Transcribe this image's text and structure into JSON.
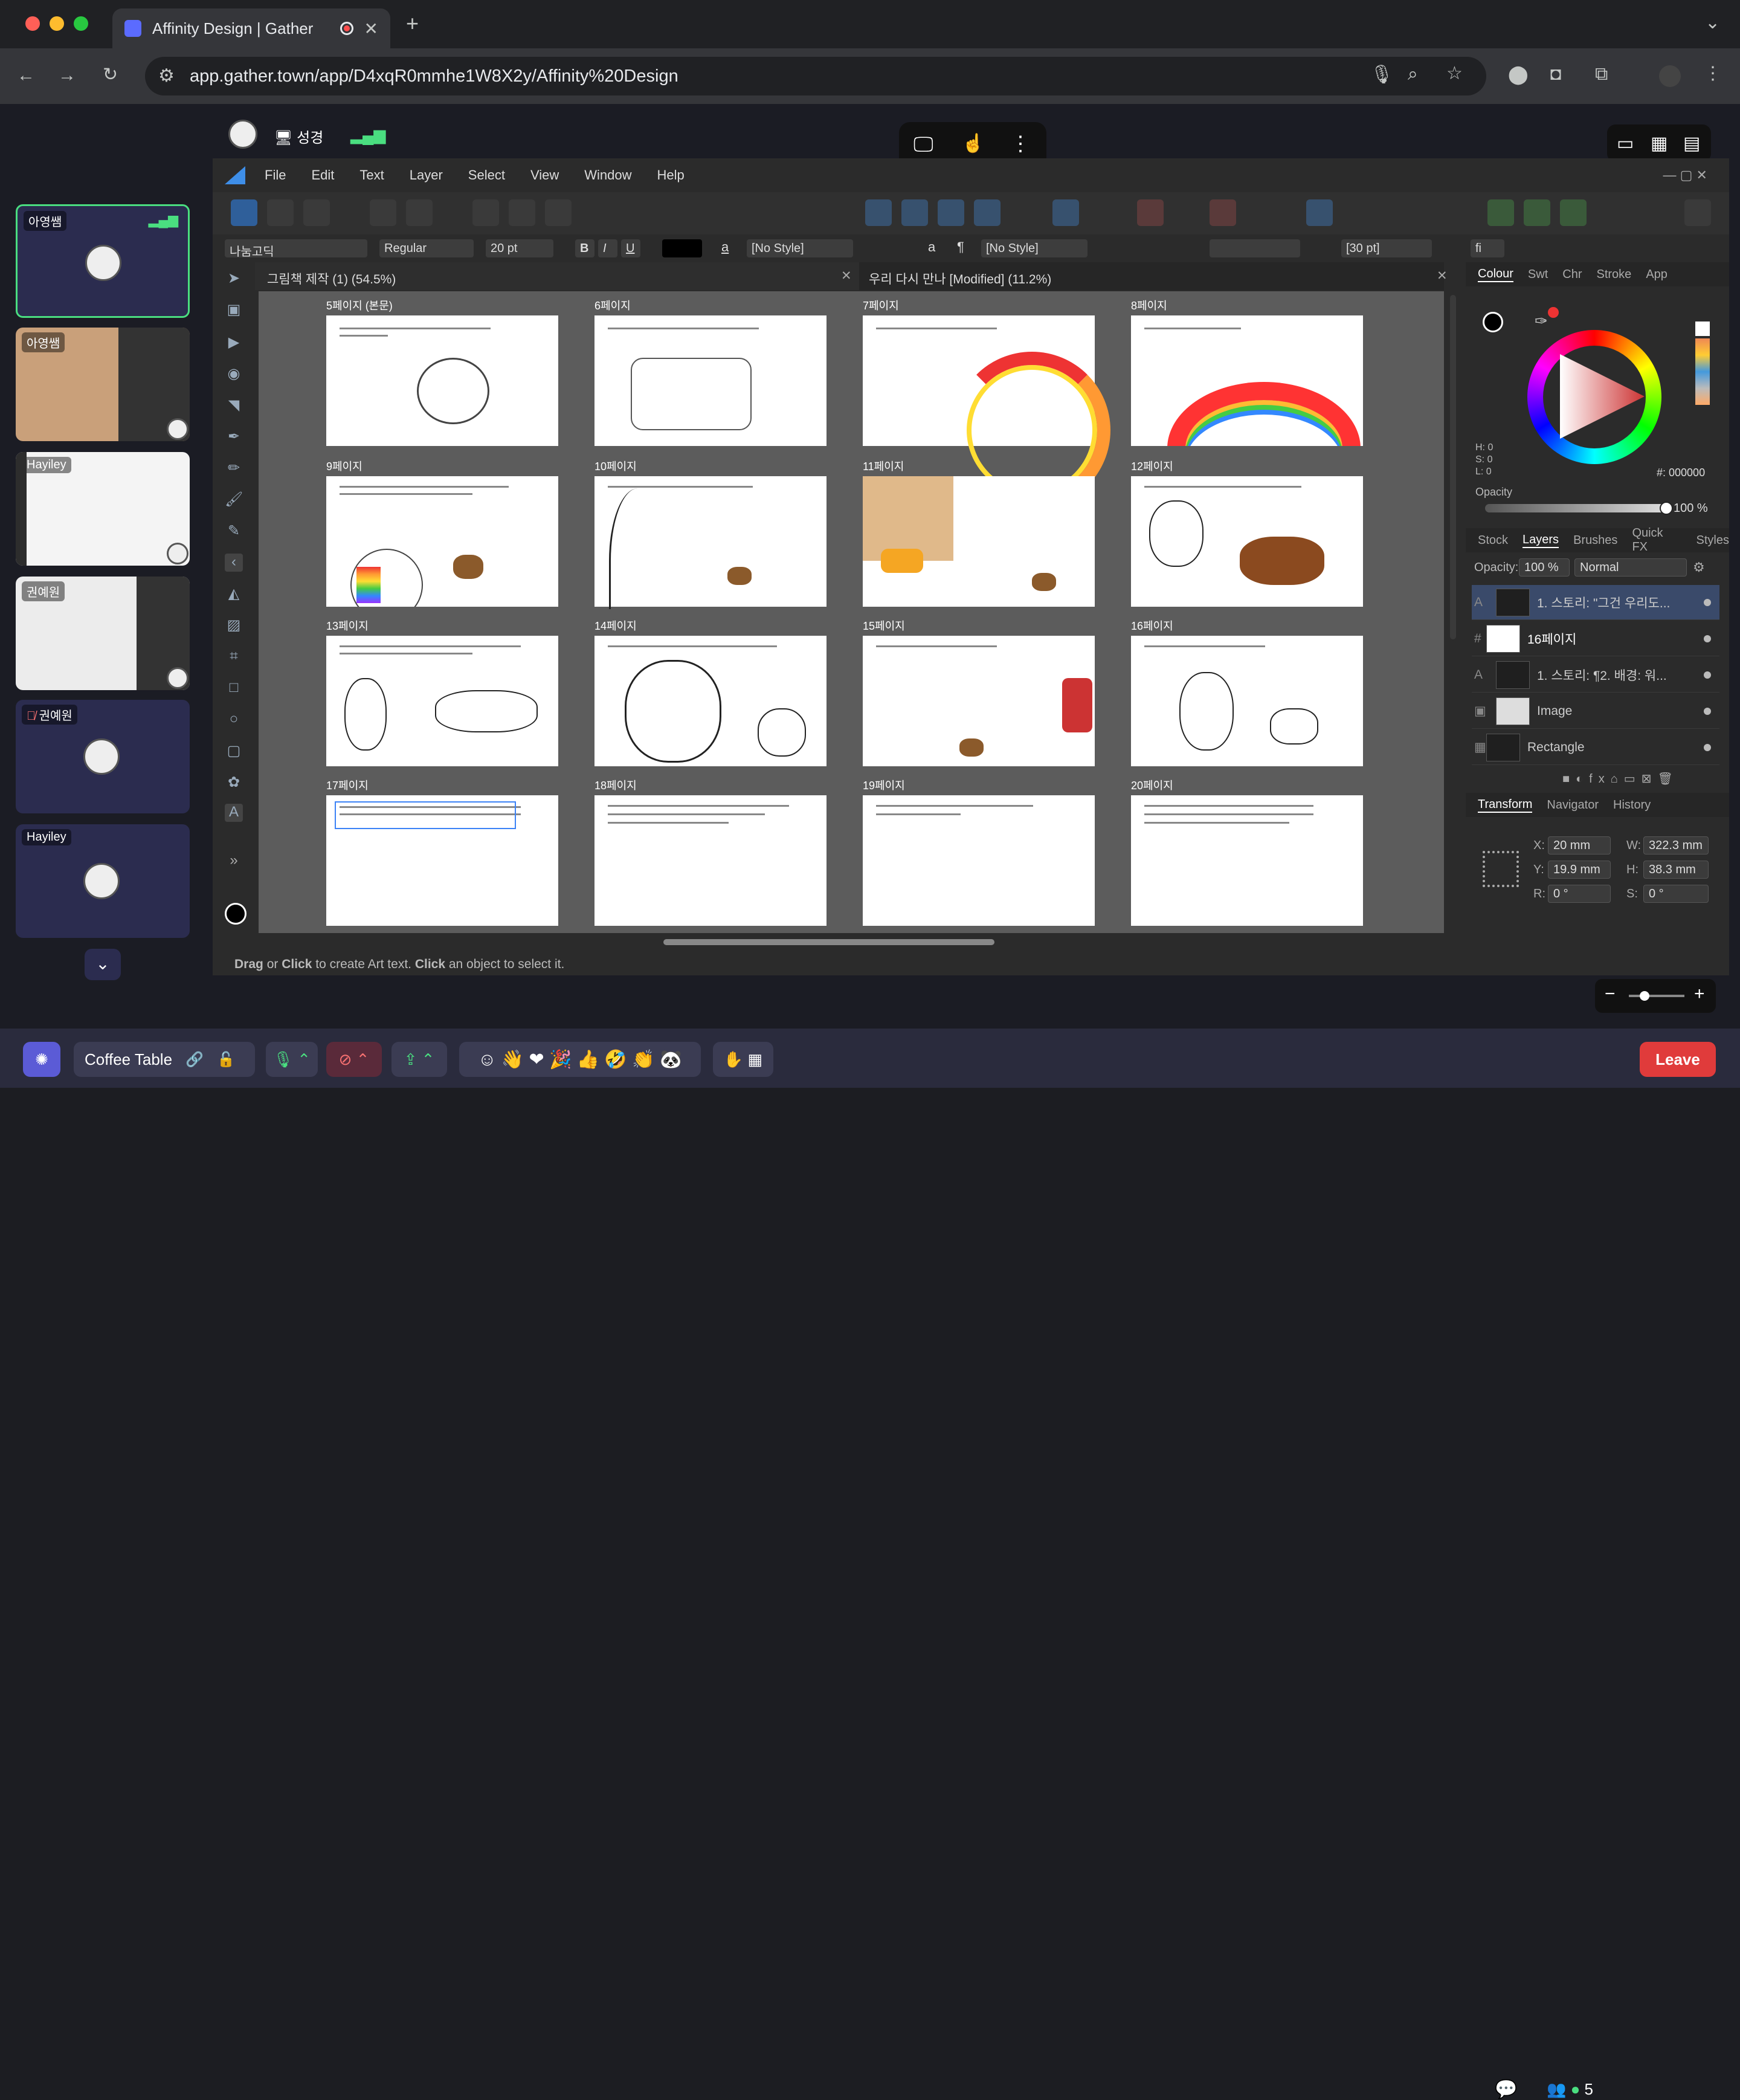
{
  "browser": {
    "tab_title": "Affinity Design | Gather",
    "url": "app.gather.town/app/D4xqR0mmhe1W8X2y/Affinity%20Design"
  },
  "gather": {
    "presenter_name": "성경",
    "participants": [
      {
        "name": "아영쌤",
        "kind": "avatar"
      },
      {
        "name": "아영쌤",
        "kind": "screen"
      },
      {
        "name": "Hayiley",
        "kind": "screen"
      },
      {
        "name": "권예원",
        "kind": "screen"
      },
      {
        "name": "권예원",
        "kind": "avatar",
        "muted": true
      },
      {
        "name": "Hayiley",
        "kind": "avatar"
      }
    ],
    "room_name": "Coffee Table",
    "participant_count": "5",
    "leave_label": "Leave"
  },
  "affinity": {
    "menu": [
      "File",
      "Edit",
      "Text",
      "Layer",
      "Select",
      "View",
      "Window",
      "Help"
    ],
    "context": {
      "font": "나눔고딕",
      "style": "Regular",
      "size": "20 pt",
      "bold": "B",
      "italic": "I",
      "underline": "U",
      "char_style": "[No Style]",
      "para_style": "[No Style]",
      "leading": "[30 pt]",
      "ligature": "fi",
      "a_glyph": "a",
      "para_glyph": "¶"
    },
    "doc_tabs": [
      {
        "label": "그림책 제작 (1) (54.5%)"
      },
      {
        "label": "우리 다시 만나 [Modified] (11.2%)"
      }
    ],
    "pages": [
      {
        "label": "5페이지 (본문)"
      },
      {
        "label": "6페이지"
      },
      {
        "label": "7페이지"
      },
      {
        "label": "8페이지"
      },
      {
        "label": "9페이지"
      },
      {
        "label": "10페이지"
      },
      {
        "label": "11페이지"
      },
      {
        "label": "12페이지"
      },
      {
        "label": "13페이지"
      },
      {
        "label": "14페이지"
      },
      {
        "label": "15페이지"
      },
      {
        "label": "16페이지"
      },
      {
        "label": "17페이지"
      },
      {
        "label": "18페이지"
      },
      {
        "label": "19페이지"
      },
      {
        "label": "20페이지"
      }
    ],
    "status": {
      "b1": "Drag",
      "t1": " or ",
      "b2": "Click",
      "t2": " to create Art text. ",
      "b3": "Click",
      "t3": " an object to select it."
    },
    "colour": {
      "tabs": [
        "Colour",
        "Swt",
        "Chr",
        "Stroke",
        "App"
      ],
      "hsl": {
        "h": "H: 0",
        "s": "S: 0",
        "l": "L: 0"
      },
      "hex": "000000",
      "opacity_label": "Opacity",
      "opacity": "100 %",
      "opacity_fraction": 1.0
    },
    "layers": {
      "tabs": [
        "Stock",
        "Layers",
        "Brushes",
        "Quick FX",
        "Styles"
      ],
      "opacity_label": "Opacity:",
      "opacity": "100 %",
      "blend": "Normal",
      "items": [
        {
          "type": "A",
          "name": "1. 스토리: \"그건 우리도..."
        },
        {
          "type": "#",
          "name": "16페이지"
        },
        {
          "type": "A",
          "name": "1. 스토리: ¶2. 배경:  워..."
        },
        {
          "type": "img",
          "name": "Image"
        },
        {
          "type": "rect",
          "name": "Rectangle"
        }
      ]
    },
    "transform": {
      "tabs": [
        "Transform",
        "Navigator",
        "History"
      ],
      "x": "20 mm",
      "y": "19.9 mm",
      "w": "322.3 mm",
      "h": "38.3 mm",
      "r": "0 °",
      "s": "0 °",
      "labels": {
        "x": "X:",
        "y": "Y:",
        "w": "W:",
        "h": "H:",
        "r": "R:",
        "s": "S:"
      }
    }
  }
}
